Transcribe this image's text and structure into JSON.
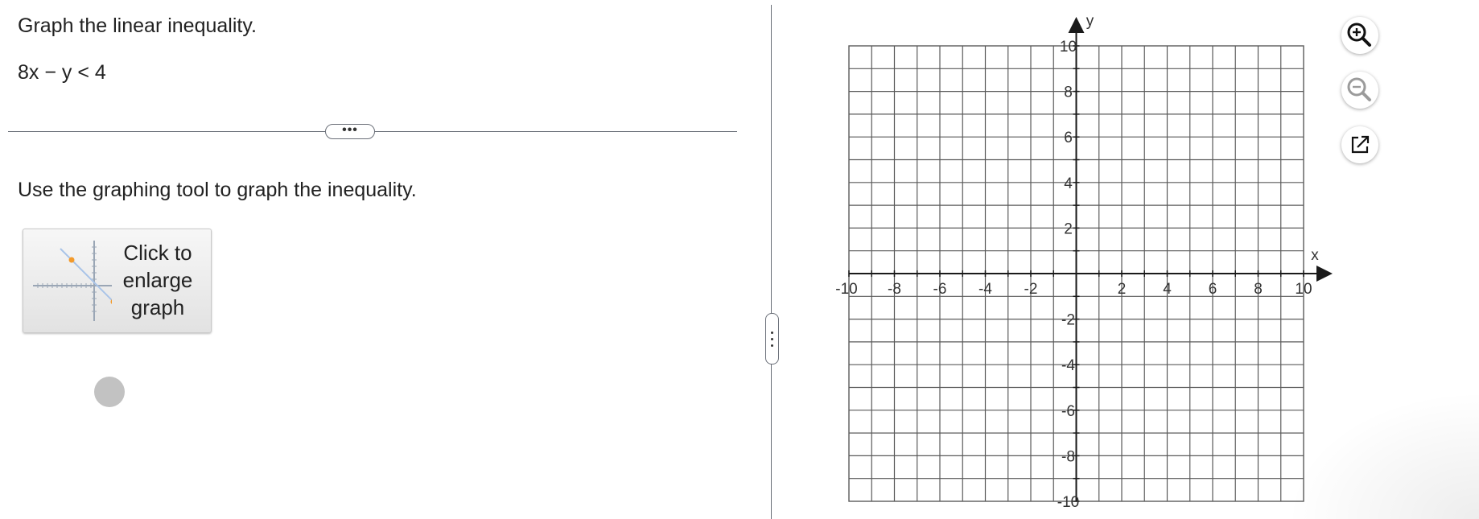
{
  "question": {
    "title": "Graph the linear inequality.",
    "equation": "8x − y < 4",
    "more_label": "•••",
    "instruction": "Use the graphing tool to graph the inequality.",
    "enlarge_button": {
      "line1": "Click to",
      "line2": "enlarge",
      "line3": "graph"
    }
  },
  "graph": {
    "x_axis_label": "x",
    "y_axis_label": "y",
    "x_range": [
      -10,
      10
    ],
    "y_range": [
      -10,
      10
    ],
    "grid_step": 1,
    "label_step": 2,
    "x_tick_labels": [
      "-10",
      "-8",
      "-6",
      "-4",
      "-2",
      "2",
      "4",
      "6",
      "8",
      "10"
    ],
    "y_tick_labels": [
      "10",
      "8",
      "6",
      "4",
      "2",
      "-2",
      "-4",
      "-6",
      "-8",
      "-10"
    ]
  },
  "tools": {
    "zoom_in": "zoom-in-icon",
    "zoom_out": "zoom-out-icon",
    "popout": "external-link-icon"
  },
  "colors": {
    "grid_line": "#5a5a5a",
    "axis": "#1a1a1a",
    "divider": "#6a6f78",
    "thumb_line": "#a9c4e8",
    "thumb_point": "#f39a2a"
  }
}
